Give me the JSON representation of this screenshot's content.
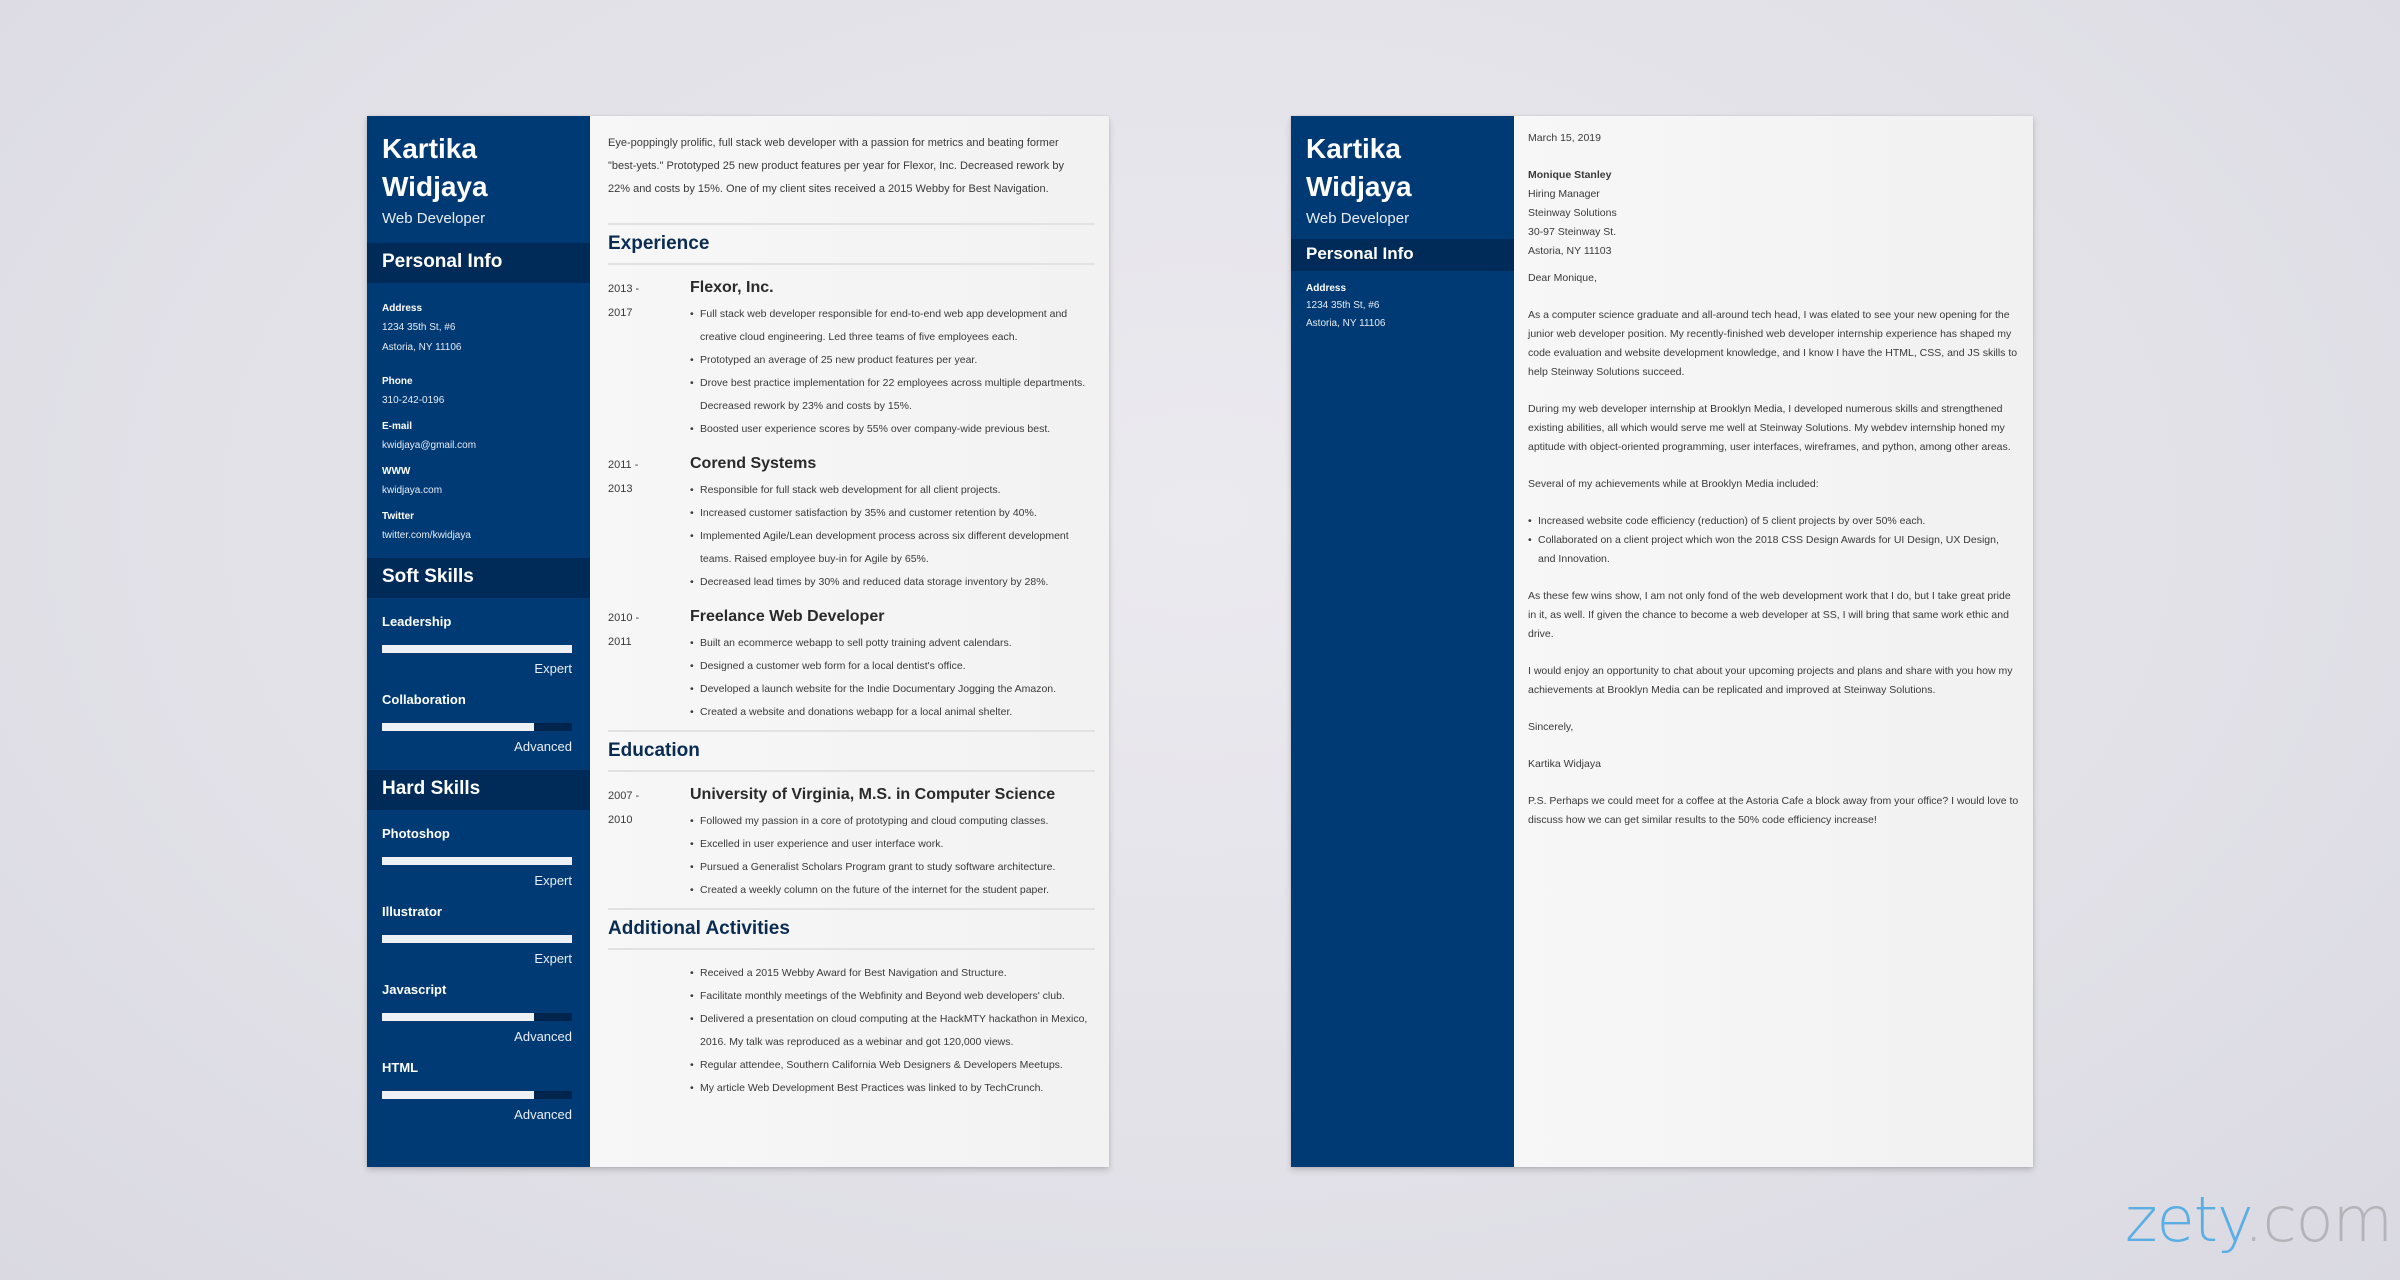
{
  "resume": {
    "name_first": "Kartika",
    "name_last": "Widjaya",
    "role": "Web Developer",
    "personal_info_heading": "Personal Info",
    "personal_info": [
      {
        "label": "Address",
        "lines": [
          "1234 35th St, #6",
          "Astoria, NY 11106"
        ]
      },
      {
        "label": "Phone",
        "lines": [
          "310-242-0196"
        ]
      },
      {
        "label": "E-mail",
        "lines": [
          "kwidjaya@gmail.com"
        ]
      },
      {
        "label": "WWW",
        "lines": [
          "kwidjaya.com"
        ]
      },
      {
        "label": "Twitter",
        "lines": [
          "twitter.com/kwidjaya"
        ]
      }
    ],
    "soft_skills_heading": "Soft Skills",
    "soft_skills": [
      {
        "name": "Leadership",
        "level": "Expert",
        "fraction": 1.0
      },
      {
        "name": "Collaboration",
        "level": "Advanced",
        "fraction": 0.8
      }
    ],
    "hard_skills_heading": "Hard Skills",
    "hard_skills": [
      {
        "name": "Photoshop",
        "level": "Expert",
        "fraction": 1.0
      },
      {
        "name": "Illustrator",
        "level": "Expert",
        "fraction": 1.0
      },
      {
        "name": "Javascript",
        "level": "Advanced",
        "fraction": 0.8
      },
      {
        "name": "HTML",
        "level": "Advanced",
        "fraction": 0.8
      }
    ],
    "summary": "Eye-poppingly prolific, full stack web developer with a passion for metrics and beating former \"best-yets.\" Prototyped 25 new product features per year for Flexor, Inc. Decreased rework by 22% and costs by 15%. One of my client sites received a 2015 Webby for Best Navigation.",
    "experience_heading": "Experience",
    "experience": [
      {
        "start": "2013 -",
        "end": "2017",
        "title": "Flexor, Inc.",
        "bullets": [
          "Full stack web developer responsible for end-to-end web app development and creative cloud engineering. Led three teams of five employees each.",
          "Prototyped an average of 25 new product features per year.",
          "Drove best practice implementation for 22 employees across multiple departments. Decreased rework by 23% and costs by 15%.",
          "Boosted user experience scores by 55% over company-wide previous best."
        ]
      },
      {
        "start": "2011 -",
        "end": "2013",
        "title": "Corend Systems",
        "bullets": [
          "Responsible for full stack web development for all client projects.",
          "Increased customer satisfaction by 35% and customer retention by 40%.",
          "Implemented Agile/Lean development process across six different development teams. Raised employee buy-in for Agile by 65%.",
          "Decreased lead times by 30% and reduced data storage inventory by 28%."
        ]
      },
      {
        "start": "2010 -",
        "end": "2011",
        "title": "Freelance Web Developer",
        "bullets": [
          "Built an ecommerce webapp to sell potty training advent calendars.",
          "Designed a customer web form for a local dentist's office.",
          "Developed a launch website for the Indie Documentary Jogging the Amazon.",
          "Created a website and donations webapp for a local animal shelter."
        ]
      }
    ],
    "education_heading": "Education",
    "education": [
      {
        "start": "2007 -",
        "end": "2010",
        "title": "University of Virginia, M.S. in Computer Science",
        "bullets": [
          "Followed my passion in a core of prototyping and cloud computing classes.",
          "Excelled in user experience and user interface work.",
          "Pursued a Generalist Scholars Program grant to study software architecture.",
          "Created a weekly column on the future of the internet for the student paper."
        ]
      }
    ],
    "activities_heading": "Additional Activities",
    "activities": [
      "Received a 2015 Webby Award for Best Navigation and Structure.",
      "Facilitate monthly meetings of the Webfinity and Beyond web developers' club.",
      "Delivered a presentation on cloud computing at the HackMTY hackathon in Mexico, 2016. My talk was reproduced as a webinar and got 120,000 views.",
      "Regular attendee, Southern California Web Designers & Developers Meetups.",
      "My article Web Development Best Practices was linked to by TechCrunch."
    ]
  },
  "letter": {
    "name_first": "Kartika",
    "name_last": "Widjaya",
    "role": "Web Developer",
    "personal_info_heading": "Personal Info",
    "address_label": "Address",
    "address_lines": [
      "1234 35th St, #6",
      "Astoria, NY 11106"
    ],
    "date": "March 15, 2019",
    "recipient": {
      "name": "Monique Stanley",
      "lines": [
        "Hiring Manager",
        "Steinway Solutions",
        "30-97 Steinway St.",
        "Astoria, NY 11103"
      ]
    },
    "greeting": "Dear Monique,",
    "paragraphs": [
      "As a computer science graduate and all-around tech head, I was elated to see your new opening for the junior web developer position. My recently-finished web developer internship experience has shaped my code evaluation and website development knowledge, and I know I have the HTML, CSS, and JS skills to help Steinway Solutions succeed.",
      "During my web developer internship at Brooklyn Media, I developed numerous skills and strengthened existing abilities, all which would serve me well at Steinway Solutions. My webdev internship honed my aptitude with object-oriented programming, user interfaces, wireframes, and python, among other areas.",
      "Several of my achievements while at Brooklyn Media included:"
    ],
    "achievements": [
      "Increased website code efficiency (reduction) of 5 client projects by over 50% each.",
      "Collaborated on a client project which won the 2018 CSS Design Awards for UI Design, UX Design, and Innovation."
    ],
    "paragraphs_after": [
      "As these few wins show, I am not only fond of the web development work that I do, but I take great pride in it, as well. If given the chance to become a web developer at SS, I will bring that same work ethic and drive.",
      "I would enjoy an opportunity to chat about your upcoming projects and plans and share with you how my achievements at Brooklyn Media can be replicated and improved at Steinway Solutions."
    ],
    "closing": "Sincerely,",
    "signature": "Kartika Widjaya",
    "ps": "P.S. Perhaps we could meet for a coffee at the Astoria Cafe a block away from your office? I would love to discuss how we can get similar results to the 50% code efficiency increase!"
  },
  "logo": {
    "part1": "zety",
    "part2": ".com"
  },
  "colors": {
    "sidebar": "#003a75",
    "sidebar_header": "#002a57",
    "heading": "#0b2c52",
    "logo_blue": "#5aaee3",
    "logo_gray": "#b3b3b8"
  }
}
